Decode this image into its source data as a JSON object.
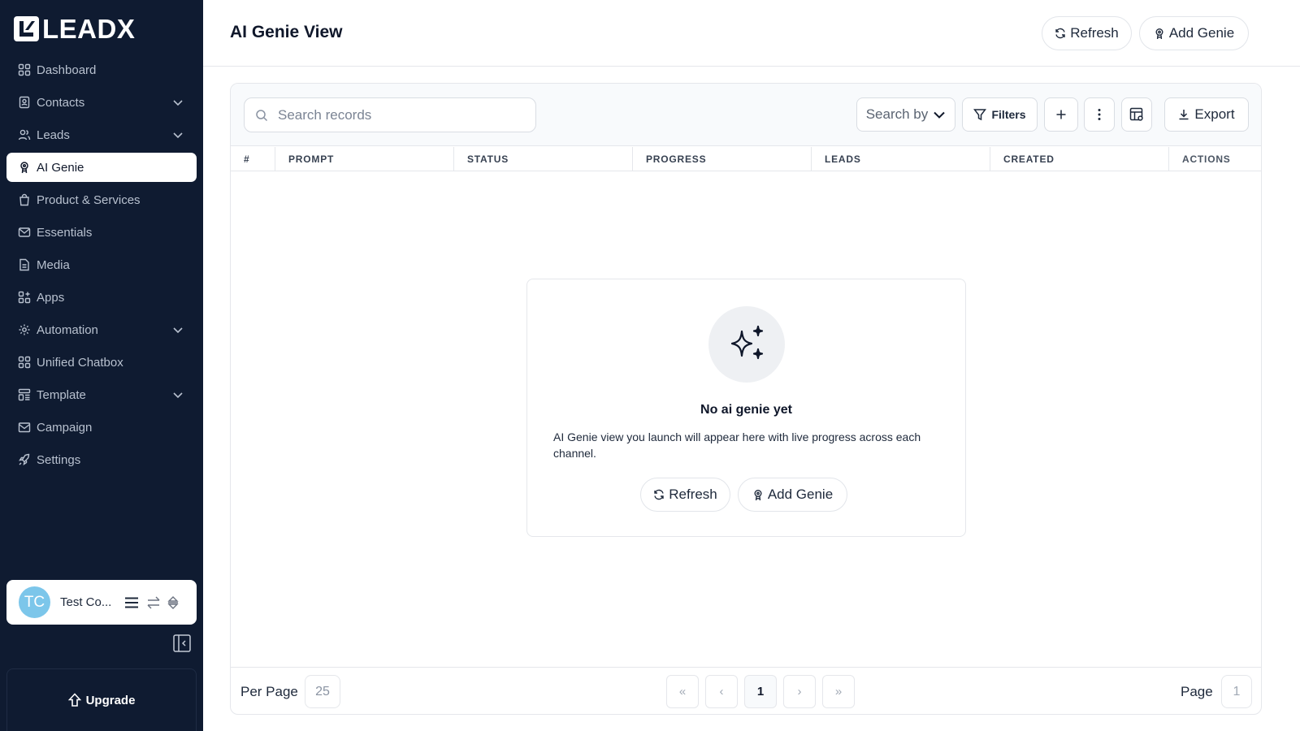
{
  "brand": {
    "name": "LEADX"
  },
  "sidebar": {
    "items": [
      {
        "label": "Dashboard",
        "icon": "grid-icon",
        "expandable": false,
        "active": false
      },
      {
        "label": "Contacts",
        "icon": "contact-book-icon",
        "expandable": true,
        "active": false
      },
      {
        "label": "Leads",
        "icon": "users-icon",
        "expandable": true,
        "active": false
      },
      {
        "label": "AI Genie",
        "icon": "genie-icon",
        "expandable": false,
        "active": true
      },
      {
        "label": "Product & Services",
        "icon": "shopping-bag-icon",
        "expandable": false,
        "active": false
      },
      {
        "label": "Essentials",
        "icon": "mail-icon",
        "expandable": false,
        "active": false
      },
      {
        "label": "Media",
        "icon": "file-icon",
        "expandable": false,
        "active": false
      },
      {
        "label": "Apps",
        "icon": "apps-grid-icon",
        "expandable": false,
        "active": false
      },
      {
        "label": "Automation",
        "icon": "gear-icon",
        "expandable": true,
        "active": false
      },
      {
        "label": "Unified Chatbox",
        "icon": "grid-icon",
        "expandable": false,
        "active": false
      },
      {
        "label": "Template",
        "icon": "template-icon",
        "expandable": true,
        "active": false
      },
      {
        "label": "Campaign",
        "icon": "mail-open-icon",
        "expandable": false,
        "active": false
      },
      {
        "label": "Settings",
        "icon": "rocket-icon",
        "expandable": false,
        "active": false
      }
    ],
    "user": {
      "initials": "TC",
      "name": "Test Co..."
    },
    "upgrade_label": "Upgrade"
  },
  "header": {
    "title": "AI Genie View",
    "refresh_label": "Refresh",
    "add_label": "Add Genie"
  },
  "toolbar": {
    "search_placeholder": "Search records",
    "search_by_label": "Search by",
    "filters_label": "Filters",
    "export_label": "Export"
  },
  "table": {
    "columns": [
      "#",
      "PROMPT",
      "STATUS",
      "PROGRESS",
      "LEADS",
      "CREATED",
      "ACTIONS"
    ]
  },
  "empty_state": {
    "title": "No ai genie yet",
    "description": "AI Genie view you launch will appear here with live progress across each channel.",
    "refresh_label": "Refresh",
    "add_label": "Add Genie"
  },
  "pagination": {
    "per_page_label": "Per Page",
    "per_page_value": "25",
    "current_page": "1",
    "page_label": "Page",
    "page_value": "1",
    "first": "«",
    "prev": "‹",
    "next": "›",
    "last": "»"
  },
  "colors": {
    "sidebar_bg": "#0f1b31",
    "accent_avatar": "#7cc6ea"
  }
}
